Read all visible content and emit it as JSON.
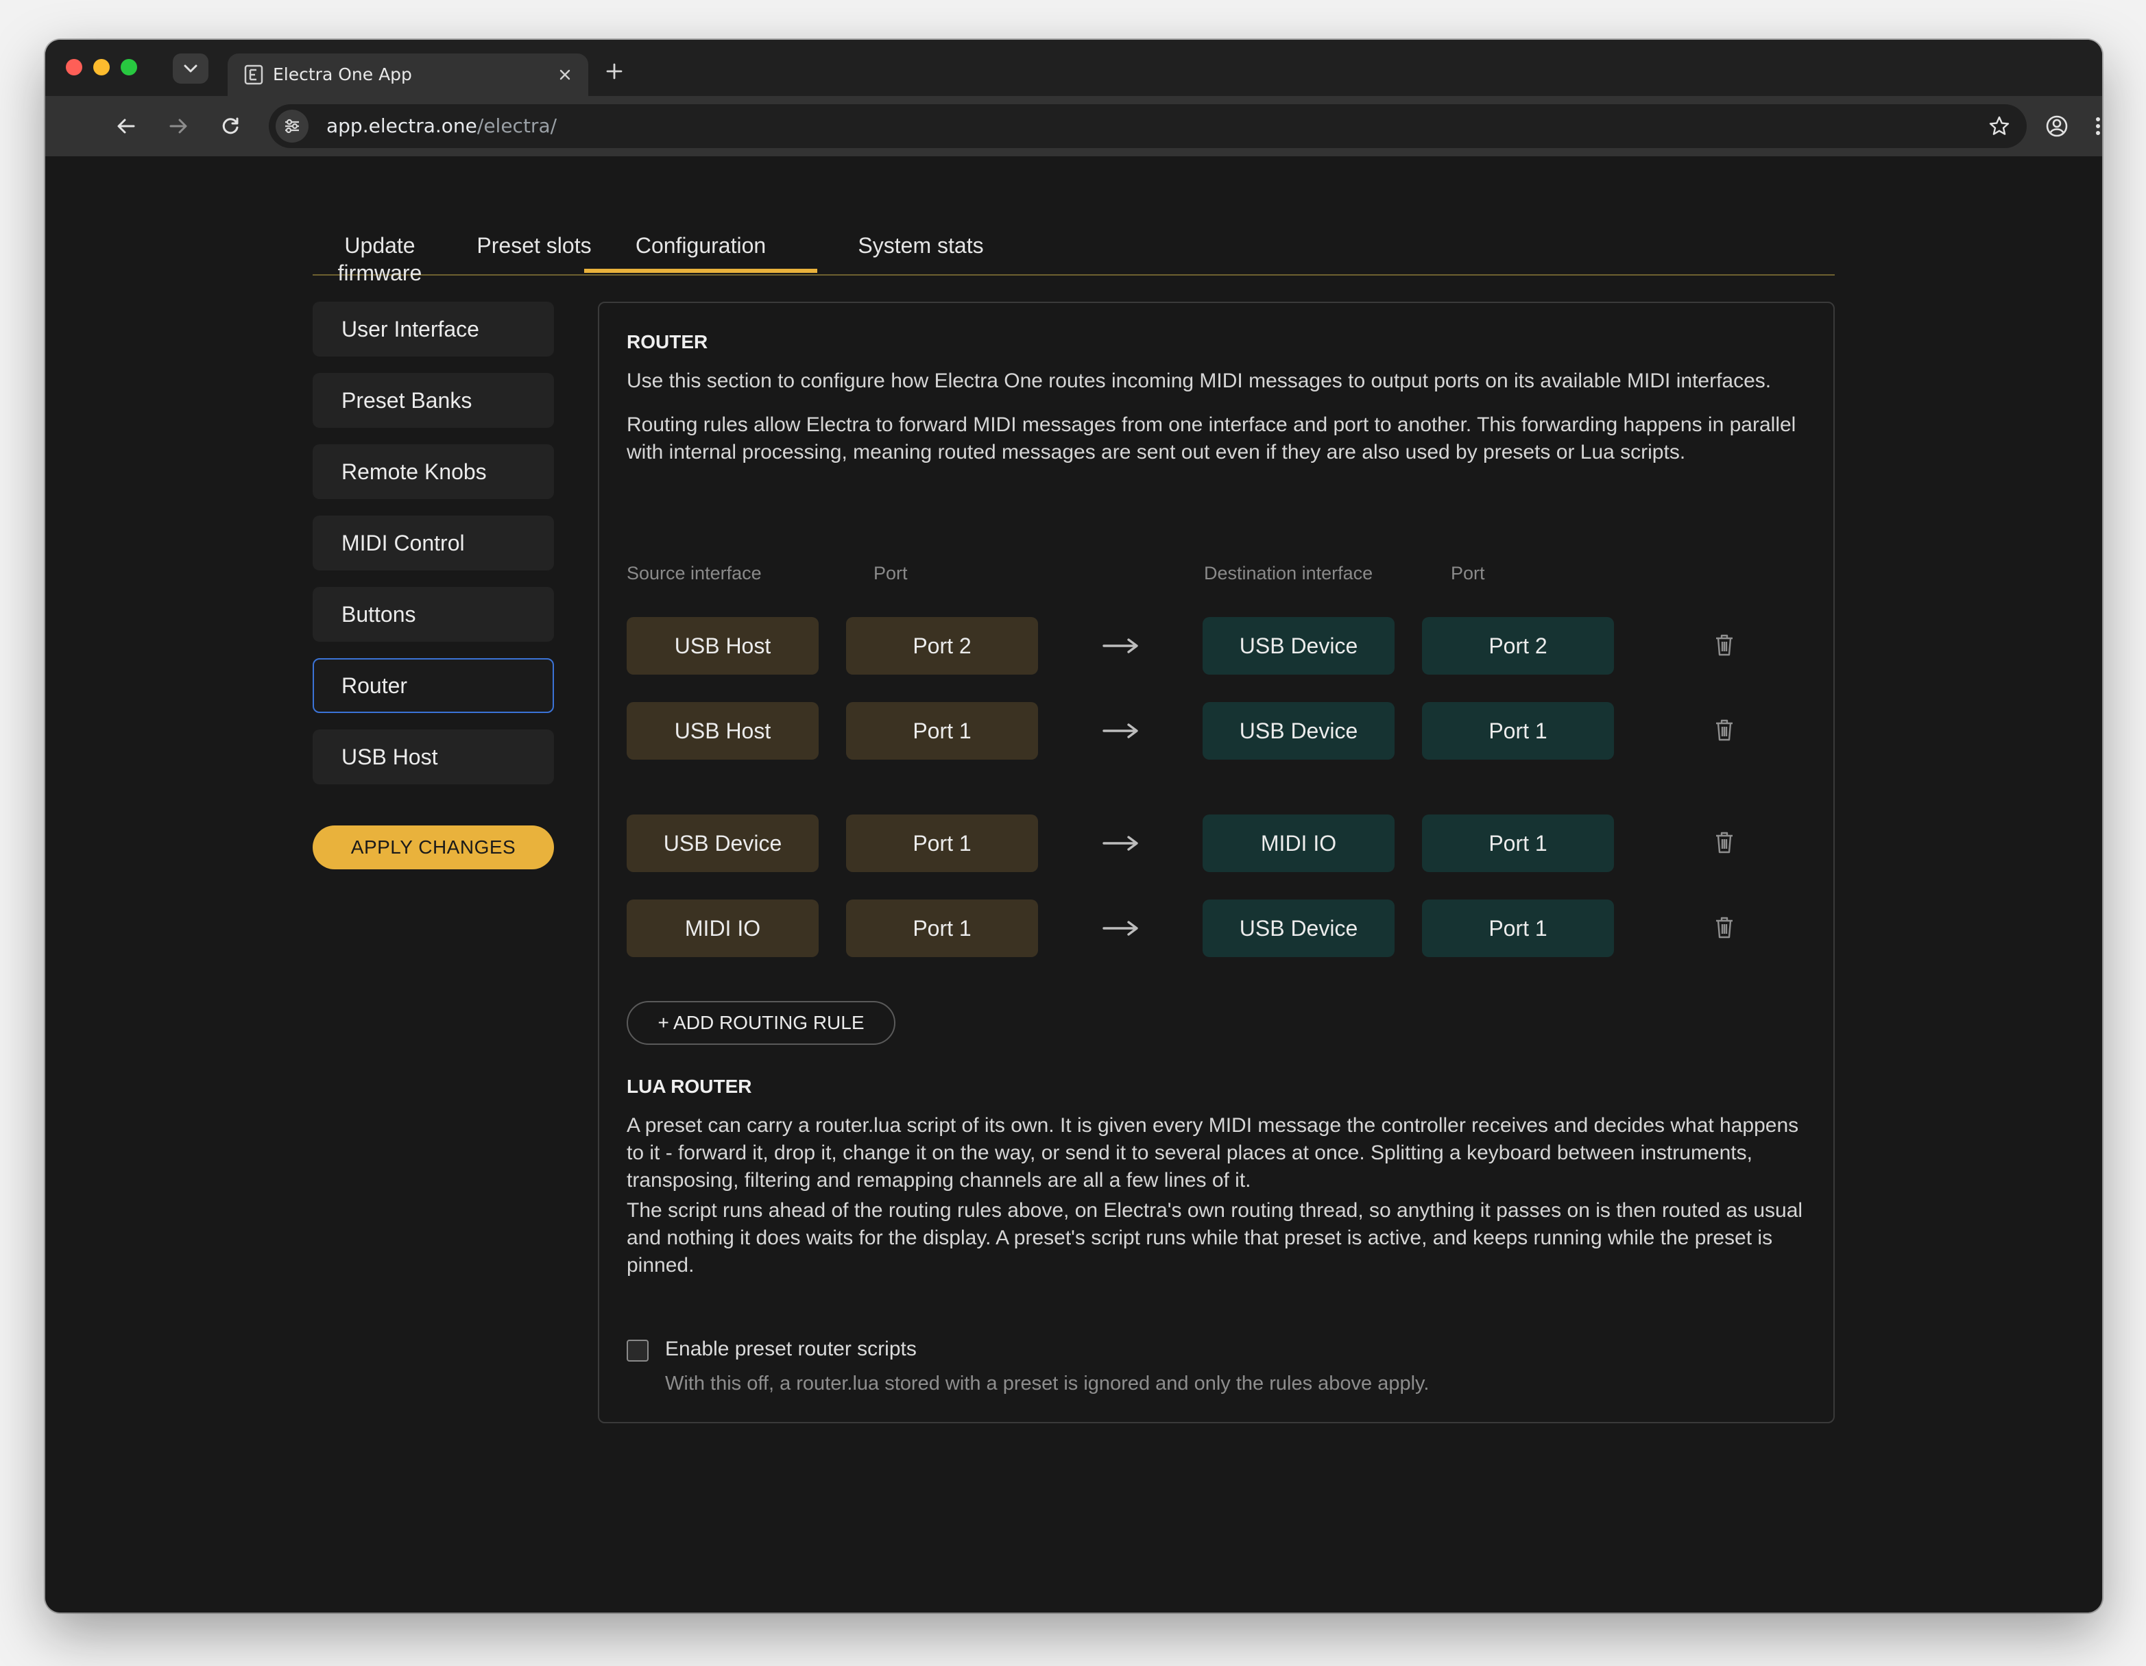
{
  "browser": {
    "tab_title": "Electra One App",
    "url_host": "app.electra.one",
    "url_path": "/electra/"
  },
  "top_tabs": [
    {
      "label": "Update firmware"
    },
    {
      "label": "Preset slots"
    },
    {
      "label": "Configuration",
      "active": true
    },
    {
      "label": "System stats"
    }
  ],
  "sidebar": {
    "items": [
      {
        "label": "User Interface"
      },
      {
        "label": "Preset Banks"
      },
      {
        "label": "Remote Knobs"
      },
      {
        "label": "MIDI Control"
      },
      {
        "label": "Buttons"
      },
      {
        "label": "Router",
        "active": true
      },
      {
        "label": "USB Host"
      }
    ],
    "apply_label": "APPLY CHANGES"
  },
  "router": {
    "title": "ROUTER",
    "para1": "Use this section to configure how Electra One routes incoming MIDI messages to output ports on its available MIDI interfaces.",
    "para2": "Routing rules allow Electra to forward MIDI messages from one interface and port to another. This forwarding happens in parallel with internal processing, meaning routed messages are sent out even if they are also used by presets or Lua scripts.",
    "headers": {
      "source_interface": "Source interface",
      "source_port": "Port",
      "dest_interface": "Destination interface",
      "dest_port": "Port"
    },
    "rules": [
      {
        "source": "USB Host",
        "source_port": "Port 2",
        "dest": "USB Device",
        "dest_port": "Port 2"
      },
      {
        "source": "USB Host",
        "source_port": "Port 1",
        "dest": "USB Device",
        "dest_port": "Port 1"
      },
      {
        "source": "USB Device",
        "source_port": "Port 1",
        "dest": "MIDI IO",
        "dest_port": "Port 1"
      },
      {
        "source": "MIDI IO",
        "source_port": "Port 1",
        "dest": "USB Device",
        "dest_port": "Port 1"
      }
    ],
    "add_rule_label": "+ ADD ROUTING RULE"
  },
  "lua_router": {
    "title": "LUA ROUTER",
    "para1": "A preset can carry a router.lua script of its own. It is given every MIDI message the controller receives and decides what happens to it - forward it, drop it, change it on the way, or send it to several places at once. Splitting a keyboard between instruments, transposing, filtering and remapping channels are all a few lines of it.",
    "para2": "The script runs ahead of the routing rules above, on Electra's own routing thread, so anything it passes on is then routed as usual and nothing it does waits for the display. A preset's script runs while that preset is active, and keeps running while the preset is pinned.",
    "checkbox_label": "Enable preset router scripts",
    "checkbox_checked": false,
    "checkbox_help": "With this off, a router.lua stored with a preset is ignored and only the rules above apply."
  },
  "colors": {
    "accent": "#e9b23c",
    "source_pill": "#3b3222",
    "dest_pill": "#163332",
    "focus_ring": "#3b73d6"
  },
  "icons": {
    "route_arrow": "arrow-right-icon",
    "delete": "trash-icon"
  }
}
